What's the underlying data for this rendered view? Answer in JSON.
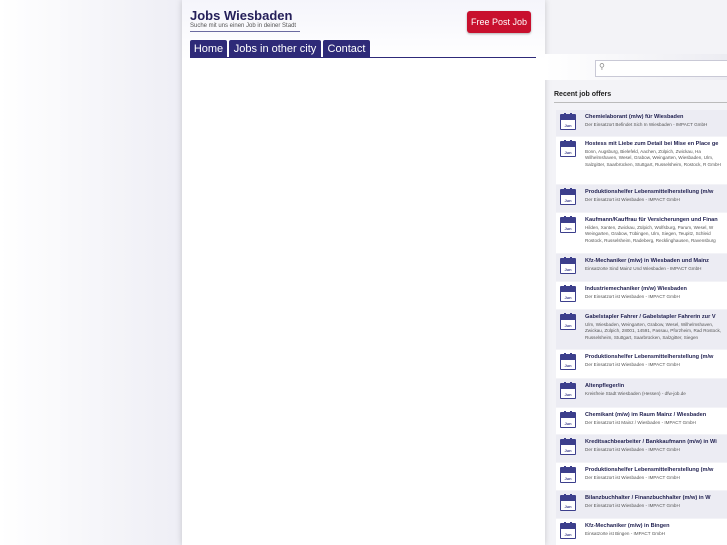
{
  "site": {
    "title": "Jobs Wiesbaden",
    "subtitle": "Suche mit uns einen Job in deiner Stadt"
  },
  "post_button": "Free Post Job",
  "nav": [
    "Home",
    "Jobs in other city",
    "Contact"
  ],
  "search": {
    "placeholder": ""
  },
  "sidebar": {
    "heading": "Recent job offers",
    "jobs": [
      {
        "month": "Jun",
        "title": "Chemielaborant (m/w) für Wiesbaden",
        "text": "Der Einsatzort Befindet Sich In Wiesbaden - IMPACT GmbH"
      },
      {
        "month": "Jun",
        "title": "Hostess mit Liebe zum Detail bei Mise en Place ge",
        "text": "Bonn, Augsburg, Bielefeld, Aachen, Zülpich, Zwickau, Ha Wilhelmshaven, Wesel, Grabow, Weingarten, Wiesbaden, Ulm, Salzgitter, Saarbrücken, Stuttgart, Russelsheim, Rostock, R GmbH"
      },
      {
        "month": "Jun",
        "title": "Produktionshelfer Lebensmittelherstellung (m/w",
        "text": "Der Einsatzort ist Wiesbaden - IMPACT GmbH"
      },
      {
        "month": "Jun",
        "title": "Kaufmann/Kauffrau für Versicherungen und Finan",
        "text": "Hilden, Xanten, Zwickau, Zülpich, Wolfsburg, Parum, Wesel, W Weingarten, Grabow, Tübingen, Ulm, Siegen, Teupitz, Schleid Rostock, Russelsheim, Radeberg, Recklinghausen, Ravensburg"
      },
      {
        "month": "Jun",
        "title": "Kfz-Mechaniker (m/w) in Wiesbaden und Mainz",
        "text": "Einsatzorte Sind Mainz Und Wiesbaden - IMPACT GmbH"
      },
      {
        "month": "Jun",
        "title": "Industriemechaniker (m/w) Wiesbaden",
        "text": "Der Einsatzort ist Wiesbaden - IMPACT GmbH"
      },
      {
        "month": "Jun",
        "title": "Gabelstapler Fahrer / Gabelstapler Fahrerin zur V",
        "text": "Ulm, Wiesbaden, Weingarten, Grabow, Wesel, Wilhelmshaven, Zwickau, Zülpich, 28001, 14591, Passau, Pforzheim, Rad Rostock, Russelsheim, Stuttgart, Saarbrücken, Salzgitter, Siegen"
      },
      {
        "month": "Jun",
        "title": "Produktionshelfer Lebensmittelherstellung (m/w",
        "text": "Der Einsatzort ist Wiesbaden - IMPACT GmbH"
      },
      {
        "month": "Jun",
        "title": "Altenpfleger/in",
        "text": "Kreisfreie Stadt Wiesbaden (Hessen) - dfw-job.de"
      },
      {
        "month": "Jun",
        "title": "Chemikant (m/w) im Raum Mainz / Wiesbaden",
        "text": "Der Einsatzort ist Mainz / Wiesbaden - IMPACT GmbH"
      },
      {
        "month": "Jun",
        "title": "Kreditsachbearbeiter / Bankkaufmann (m/w) in Wi",
        "text": "Der Einsatzort ist Wiesbaden - IMPACT GmbH"
      },
      {
        "month": "Jun",
        "title": "Produktionshelfer Lebensmittelherstellung (m/w",
        "text": "Der Einsatzort ist Wiesbaden - IMPACT GmbH"
      },
      {
        "month": "Jun",
        "title": "Bilanzbuchhalter / Finanzbuchhalter (m/w) in W",
        "text": "Der Einsatzort ist Wiesbaden - IMPACT GmbH"
      },
      {
        "month": "Jun",
        "title": "Kfz-Mechaniker (m/w) in Bingen",
        "text": "Einsatzorte ist Bingen - IMPACT GmbH"
      }
    ]
  },
  "colors": {
    "nav_bg": "#2e2a78",
    "button_bg": "#c8102e",
    "calendar": "#3c3f8c"
  }
}
